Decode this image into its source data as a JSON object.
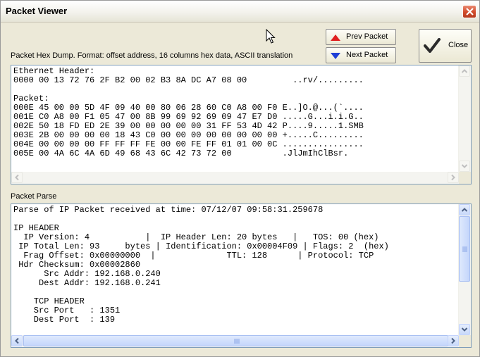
{
  "window": {
    "title": "Packet Viewer"
  },
  "hex": {
    "caption": "Packet Hex Dump.  Format: offset address, 16 columns hex data, ASCII translation",
    "content": "Ethernet Header:\n0000 00 13 72 76 2F B2 00 02 B3 8A DC A7 08 00         ..rv/.........\n\nPacket:\n000E 45 00 00 5D 4F 09 40 00 80 06 28 60 C0 A8 00 F0 E..]O.@...(`....\n001E C0 A8 00 F1 05 47 00 8B 99 69 92 69 09 47 E7 D0 .....G...i.i.G..\n002E 50 18 FD ED 2E 39 00 00 00 00 00 31 FF 53 4D 42 P....9.....1.SMB\n003E 2B 00 00 00 00 18 43 C0 00 00 00 00 00 00 00 00 +.....C.........\n004E 00 00 00 00 FF FF FF FE 00 00 FE FF 01 01 00 0C ................\n005E 00 4A 6C 4A 6D 49 68 43 6C 42 73 72 00          .JlJmIhClBsr."
  },
  "parse": {
    "caption": "Packet Parse",
    "content": "Parse of IP Packet received at time: 07/12/07 09:58:31.259678\n\nIP HEADER\n  IP Version: 4           |  IP Header Len: 20 bytes   |   TOS: 00 (hex)\n IP Total Len: 93     bytes | Identification: 0x00004F09 | Flags: 2  (hex)\n  Frag Offset: 0x00000000  |              TTL: 128      | Protocol: TCP\n Hdr Checksum: 0x00002860\n      Src Addr: 192.168.0.240\n     Dest Addr: 192.168.0.241\n\n    TCP HEADER\n    Src Port   : 1351\n    Dest Port  : 139"
  },
  "buttons": {
    "prev": "Prev Packet",
    "next": "Next Packet",
    "close": "Close"
  }
}
